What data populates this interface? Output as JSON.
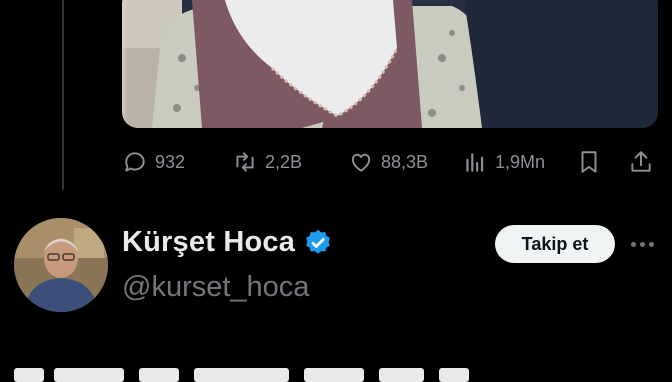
{
  "tweet": {
    "metrics": {
      "replies": "932",
      "reposts": "2,2B",
      "likes": "88,3B",
      "views": "1,9Mn"
    },
    "icons": [
      "reply-icon",
      "repost-icon",
      "like-icon",
      "views-icon",
      "bookmark-icon",
      "share-icon"
    ]
  },
  "reply_author": {
    "display_name": "Kürşet Hoca",
    "handle": "@kurset_hoca",
    "verified": true,
    "follow_label": "Takip et"
  },
  "colors": {
    "background": "#000000",
    "text": "#e7e9ea",
    "muted": "#71767b",
    "verified_blue": "#1d9bf0",
    "follow_bg": "#eff3f4"
  }
}
